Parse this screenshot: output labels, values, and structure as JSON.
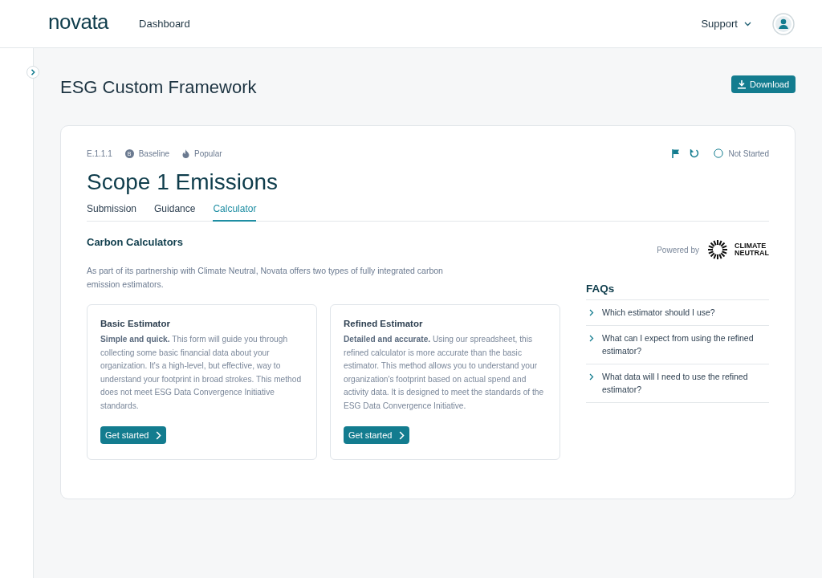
{
  "header": {
    "logo": "novata",
    "nav": [
      {
        "label": "Dashboard",
        "selected": false
      }
    ],
    "support": "Support"
  },
  "page": {
    "title": "ESG Custom Framework",
    "download": "Download"
  },
  "metric": {
    "code": "E.1.1.1",
    "tags": [
      {
        "kind": "baseline",
        "badge": "B",
        "label": "Baseline"
      },
      {
        "kind": "popular",
        "label": "Popular"
      }
    ],
    "status": "Not Started",
    "title": "Scope 1 Emissions"
  },
  "tabs": [
    {
      "label": "Submission",
      "selected": false
    },
    {
      "label": "Guidance",
      "selected": false
    },
    {
      "label": "Calculator",
      "selected": true
    }
  ],
  "calculators": {
    "title": "Carbon Calculators",
    "powered_by": "Powered by",
    "partner": [
      "CLIMATE",
      "NEUTRAL"
    ],
    "intro": "As part of its partnership with Climate Neutral, Novata offers two types of fully integrated carbon emission estimators.",
    "estimators": [
      {
        "title": "Basic Estimator",
        "text": "**Simple and quick.** This form will guide you through collecting some basic financial data about your organization. It's a high-level, but effective, way to understand your footprint in broad strokes. This method does not meet ESG Data Convergence Initiative standards.",
        "button": "Get started"
      },
      {
        "title": "Refined Estimator",
        "text": "**Detailed and accurate.** Using our spreadsheet, this refined calculator is more accurate than the basic estimator. This method allows you to understand your organization's footprint based on actual spend and activity data. It is designed to meet the standards of the ESG Data Convergence Initiative.",
        "button": "Get started"
      }
    ]
  },
  "faqs": {
    "title": "FAQs",
    "items": [
      {
        "question": "Which estimator should I use?",
        "expanded": false
      },
      {
        "question": "What can I expect from using the refined estimator?",
        "expanded": false
      },
      {
        "question": "What data will I need to use the refined estimator?",
        "expanded": false
      }
    ]
  }
}
